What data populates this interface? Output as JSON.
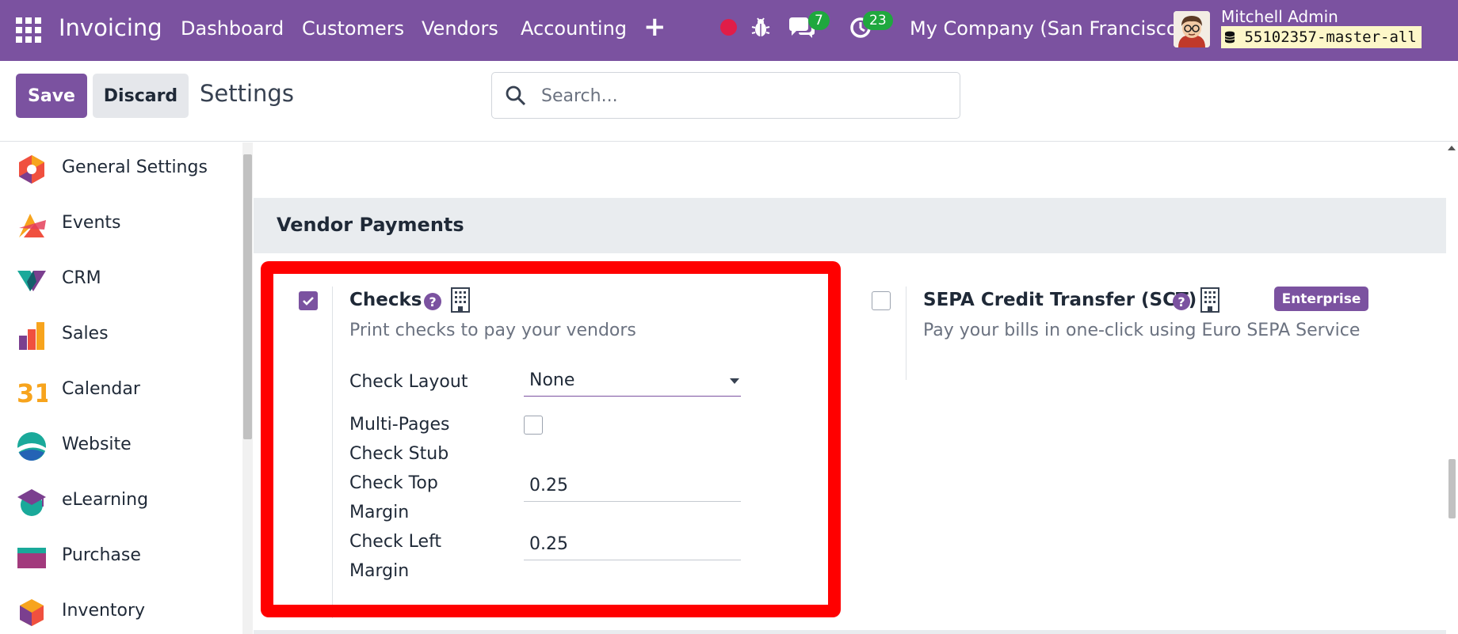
{
  "navbar": {
    "app_name": "Invoicing",
    "menu": [
      "Dashboard",
      "Customers",
      "Vendors",
      "Accounting"
    ],
    "plus": "+",
    "chat_count": "7",
    "activity_count": "23",
    "company": "My Company (San Francisco)",
    "user_name": "Mitchell Admin",
    "database": "55102357-master-all"
  },
  "control": {
    "save_label": "Save",
    "discard_label": "Discard",
    "title": "Settings",
    "search_placeholder": "Search..."
  },
  "sidebar": {
    "items": [
      {
        "label": "General Settings",
        "icon": "general-settings-icon"
      },
      {
        "label": "Events",
        "icon": "events-icon"
      },
      {
        "label": "CRM",
        "icon": "crm-icon"
      },
      {
        "label": "Sales",
        "icon": "sales-icon"
      },
      {
        "label": "Calendar",
        "icon": "calendar-icon"
      },
      {
        "label": "Website",
        "icon": "website-icon"
      },
      {
        "label": "eLearning",
        "icon": "elearning-icon"
      },
      {
        "label": "Purchase",
        "icon": "purchase-icon"
      },
      {
        "label": "Inventory",
        "icon": "inventory-icon"
      }
    ],
    "calendar_glyph": "31"
  },
  "section": {
    "title": "Vendor Payments",
    "checks": {
      "title": "Checks",
      "checked": true,
      "description": "Print checks to pay your vendors",
      "check_layout_label": "Check Layout",
      "check_layout_value": "None",
      "multi_pages_label_1": "Multi-Pages",
      "multi_pages_label_2": "Check Stub",
      "multi_pages_checked": false,
      "top_margin_label_1": "Check Top",
      "top_margin_label_2": "Margin",
      "top_margin_value": "0.25",
      "left_margin_label_1": "Check Left",
      "left_margin_label_2": "Margin",
      "left_margin_value": "0.25"
    },
    "sepa": {
      "title": "SEPA Credit Transfer (SCT)",
      "checked": false,
      "description": "Pay your bills in one-click using Euro SEPA Service",
      "tag": "Enterprise"
    },
    "help_glyph": "?"
  },
  "colors": {
    "brand": "#7b52a0",
    "highlight": "#ff0000",
    "badge": "#1fa83e"
  }
}
